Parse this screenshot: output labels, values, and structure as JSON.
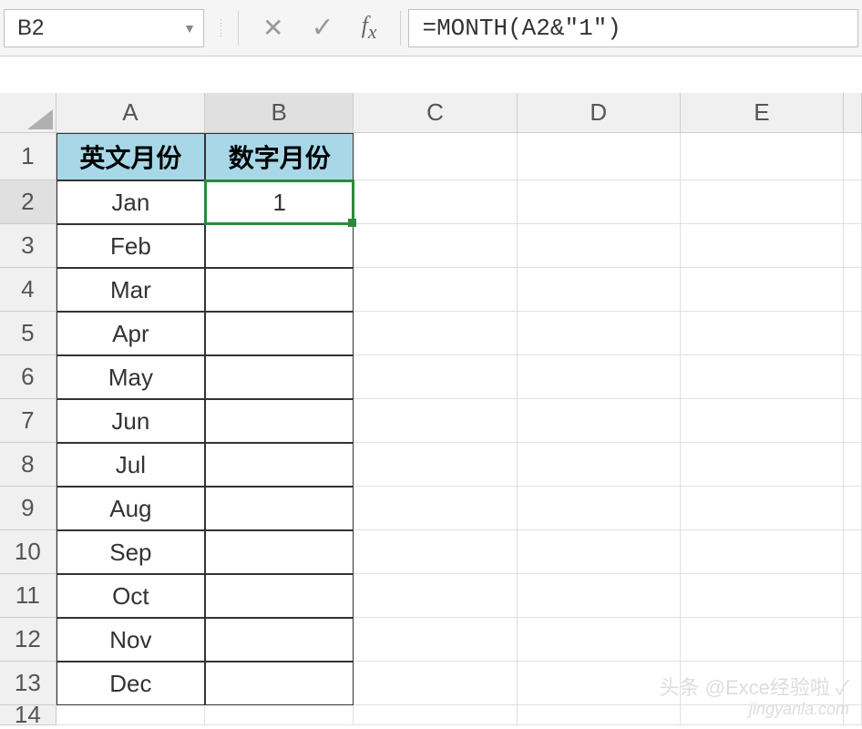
{
  "nameBox": "B2",
  "formula": "=MONTH(A2&\"1\")",
  "columns": [
    "A",
    "B",
    "C",
    "D",
    "E"
  ],
  "headers": {
    "A1": "英文月份",
    "B1": "数字月份"
  },
  "rows": [
    {
      "num": "1",
      "A": "英文月份",
      "B": "数字月份"
    },
    {
      "num": "2",
      "A": "Jan",
      "B": "1"
    },
    {
      "num": "3",
      "A": "Feb",
      "B": ""
    },
    {
      "num": "4",
      "A": "Mar",
      "B": ""
    },
    {
      "num": "5",
      "A": "Apr",
      "B": ""
    },
    {
      "num": "6",
      "A": "May",
      "B": ""
    },
    {
      "num": "7",
      "A": "Jun",
      "B": ""
    },
    {
      "num": "8",
      "A": "Jul",
      "B": ""
    },
    {
      "num": "9",
      "A": "Aug",
      "B": ""
    },
    {
      "num": "10",
      "A": "Sep",
      "B": ""
    },
    {
      "num": "11",
      "A": "Oct",
      "B": ""
    },
    {
      "num": "12",
      "A": "Nov",
      "B": ""
    },
    {
      "num": "13",
      "A": "Dec",
      "B": ""
    },
    {
      "num": "14",
      "A": "",
      "B": ""
    }
  ],
  "watermark": {
    "line1": "头条 @Exce经验啦 ✓",
    "line2": "jingyanla.com"
  },
  "activeCell": "B2"
}
